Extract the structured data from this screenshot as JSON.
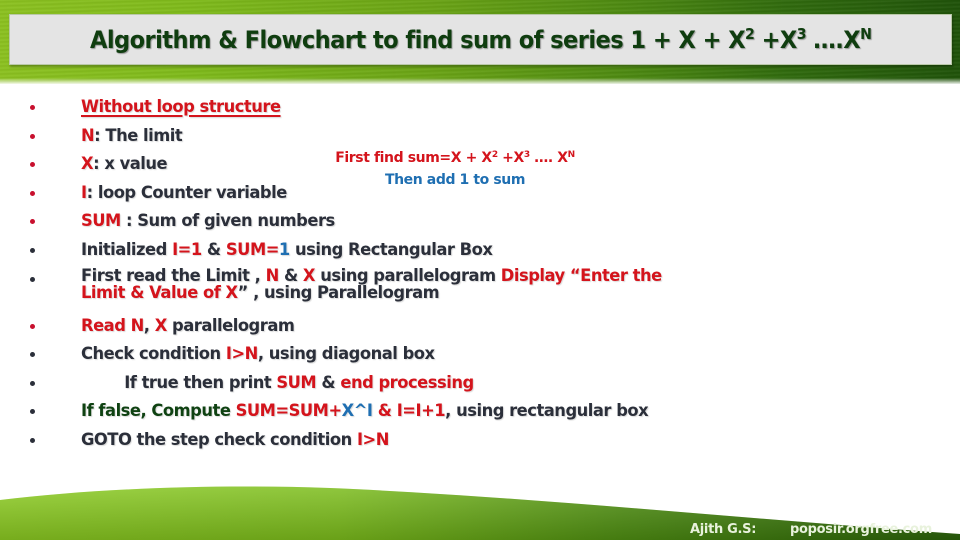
{
  "header": {
    "title_main": "Algorithm & Flowchart to find sum of series 1 + X + X",
    "sup2": "2",
    "title_mid": " +X",
    "sup3": "3",
    "title_end": " ….X",
    "supN": "N"
  },
  "note": {
    "line1_a": "First find sum=X + X",
    "line1_sup2": "2",
    "line1_b": " +X",
    "line1_sup3": "3",
    "line1_c": " …. X",
    "line1_supN": "N",
    "line2": "Then add 1 to sum"
  },
  "items": [
    {
      "bullet": "red",
      "parts": [
        "Without loop structure"
      ]
    },
    {
      "bullet": "red",
      "parts": [
        "N",
        ": The limit"
      ]
    },
    {
      "bullet": "red",
      "parts": [
        "X",
        ": x value"
      ]
    },
    {
      "bullet": "red",
      "parts": [
        "I",
        ": loop Counter variable"
      ]
    },
    {
      "bullet": "red",
      "parts": [
        "SUM",
        " : Sum of given numbers"
      ]
    },
    {
      "bullet": "dark",
      "parts": [
        "Initialized ",
        "I=1",
        " & ",
        "SUM=",
        "1",
        " using Rectangular Box"
      ]
    },
    {
      "bullet": "dark",
      "parts": [
        "First read the Limit , ",
        "N",
        " & ",
        "X",
        " using parallelogram ",
        "Display “Enter the",
        "Limit & Value of X",
        "” , using Parallelogram"
      ]
    },
    {
      "bullet": "red",
      "parts": [
        "Read N",
        ", ",
        "X",
        " parallelogram"
      ]
    },
    {
      "bullet": "dark",
      "parts": [
        "Check condition ",
        "I>N",
        ", using diagonal box"
      ]
    },
    {
      "bullet": "dark",
      "parts": [
        "If true  then print ",
        "SUM",
        " & ",
        "end processing"
      ]
    },
    {
      "bullet": "dark",
      "parts": [
        "If false, Compute ",
        "SUM=SUM+",
        "X^I",
        " & I=I+1",
        ", using rectangular box"
      ]
    },
    {
      "bullet": "dark",
      "parts": [
        "GOTO the step check condition ",
        "I>N"
      ]
    }
  ],
  "footer": {
    "author": "Ajith G.S:",
    "site": "poposir.orgfree.com"
  },
  "colors": {
    "accent_red": "#d4141c",
    "accent_blue": "#1f6fb2",
    "title_green": "#0f3d0f",
    "body_text": "#2b2f3a"
  }
}
